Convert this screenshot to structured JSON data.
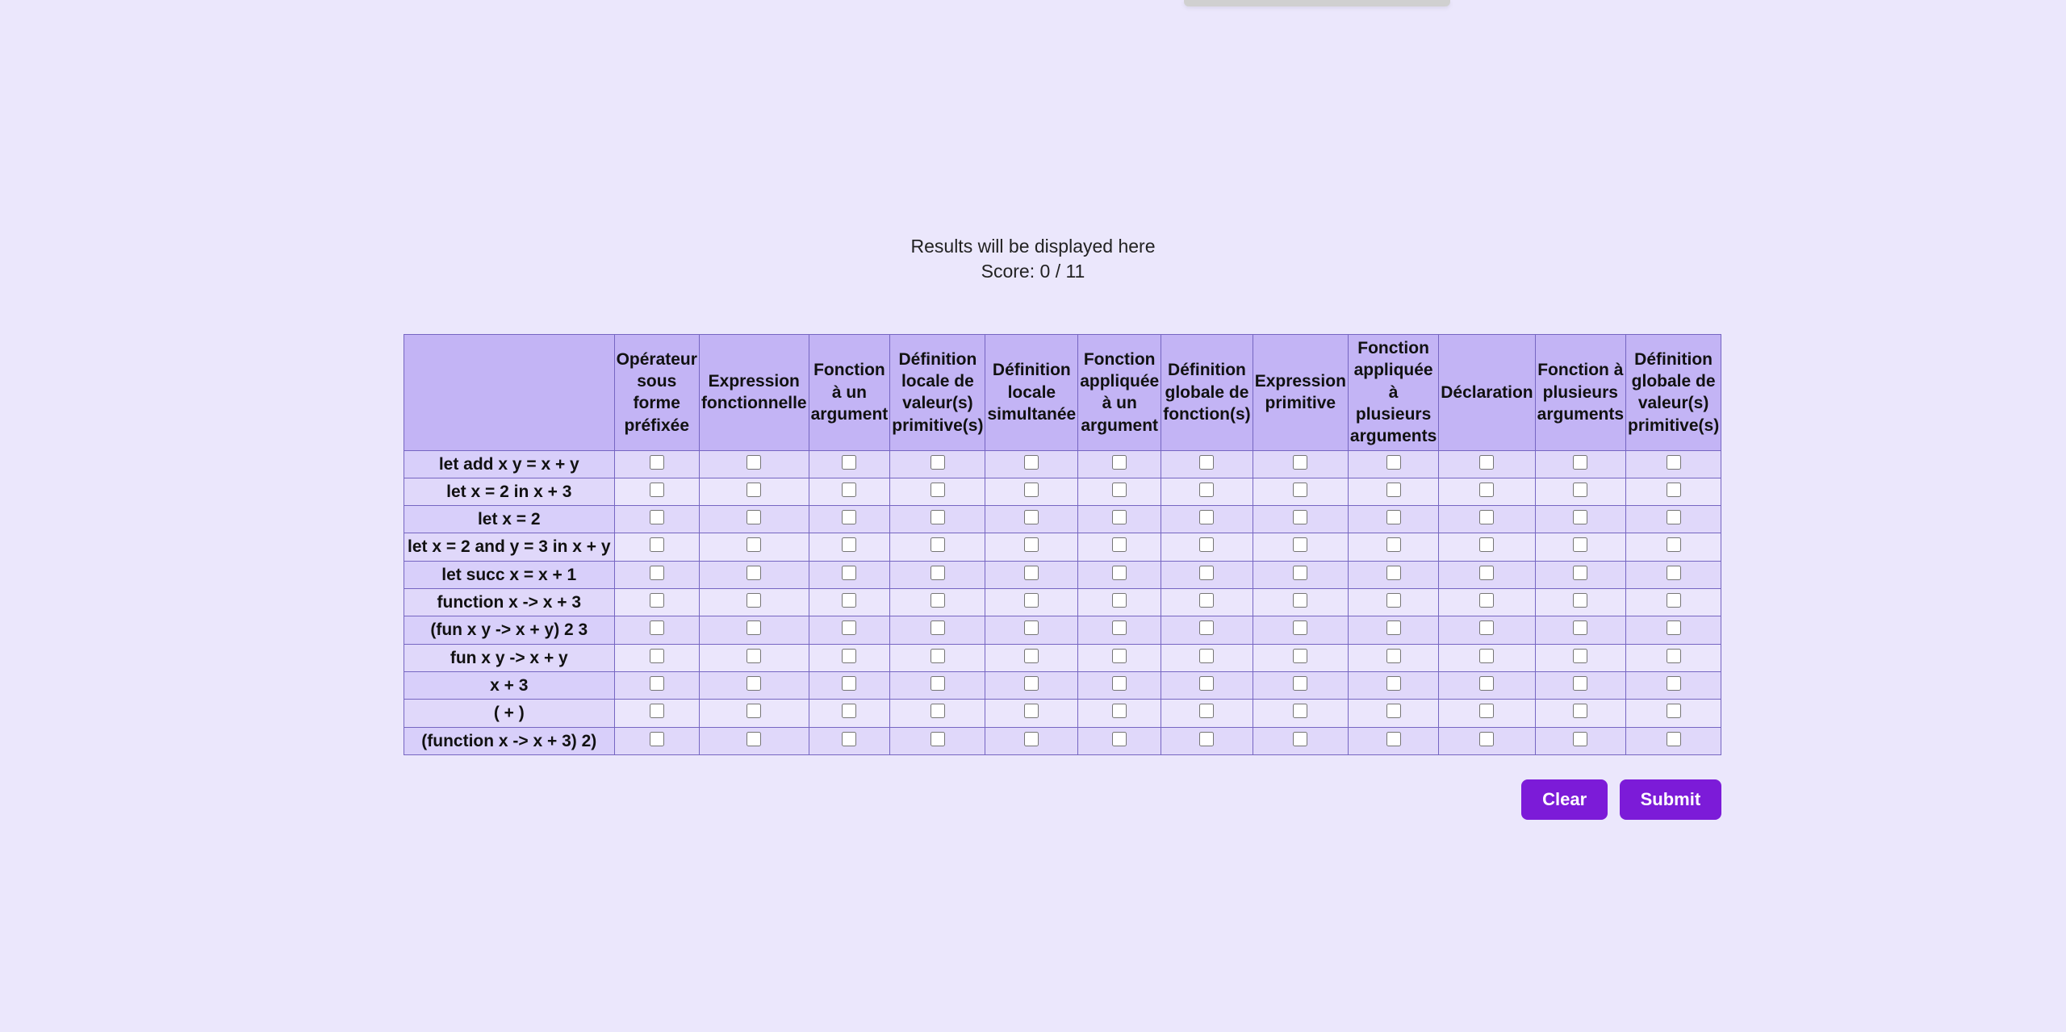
{
  "results_text": "Results will be displayed here",
  "score_label": "Score:",
  "score_current": 0,
  "score_sep": "/",
  "score_total": 11,
  "columns": [
    "Opérateur sous forme préfixée",
    "Expression fonctionnelle",
    "Fonction à un argument",
    "Définition locale de valeur(s) primitive(s)",
    "Définition locale simultanée",
    "Fonction appliquée à un argument",
    "Définition globale de fonction(s)",
    "Expression primitive",
    "Fonction appliquée à plusieurs arguments",
    "Déclaration",
    "Fonction à plusieurs arguments",
    "Définition globale de valeur(s) primitive(s)"
  ],
  "rows": [
    "let add x y = x + y",
    "let x = 2 in x + 3",
    "let x = 2",
    "let x = 2 and y = 3 in x + y",
    "let succ x = x + 1",
    "function x -> x + 3",
    "(fun x y -> x + y) 2 3",
    "fun x y -> x + y",
    "x + 3",
    "( + )",
    "(function x -> x + 3) 2)"
  ],
  "buttons": {
    "clear": "Clear",
    "submit": "Submit"
  }
}
